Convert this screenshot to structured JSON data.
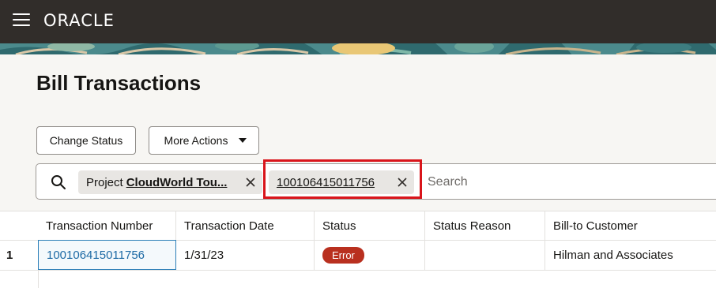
{
  "header": {
    "logo_text": "ORACLE"
  },
  "page": {
    "title": "Bill Transactions"
  },
  "toolbar": {
    "change_status_label": "Change Status",
    "more_actions_label": "More Actions"
  },
  "filters": {
    "chips": [
      {
        "label": "Project",
        "value": "CloudWorld Tou..."
      },
      {
        "label": "",
        "value": "100106415011756"
      }
    ],
    "search_placeholder": "Search"
  },
  "table": {
    "columns": [
      "Transaction Number",
      "Transaction Date",
      "Status",
      "Status Reason",
      "Bill-to Customer"
    ],
    "rows": [
      {
        "row_number": "1",
        "transaction_number": "100106415011756",
        "transaction_date": "1/31/23",
        "status": "Error",
        "status_reason": "",
        "bill_to_customer": "Hilman and Associates"
      }
    ]
  },
  "colors": {
    "topbar": "#312d2a",
    "highlight": "#d9151b",
    "error_badge": "#b9301f",
    "link": "#1d6aa5"
  }
}
